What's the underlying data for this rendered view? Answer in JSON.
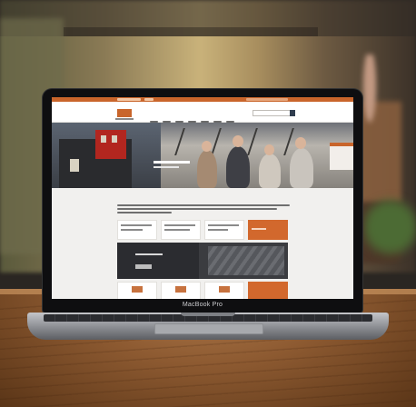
{
  "scene": {
    "description_visible": "",
    "laptop_model_label": "MacBook Pro"
  },
  "colors": {
    "brand_orange": "#c9652b",
    "dark_panel": "#3b3c40",
    "screen_bg": "#f1f0ee"
  },
  "icons": {
    "search": "search-icon",
    "logo": "brand-logo"
  }
}
